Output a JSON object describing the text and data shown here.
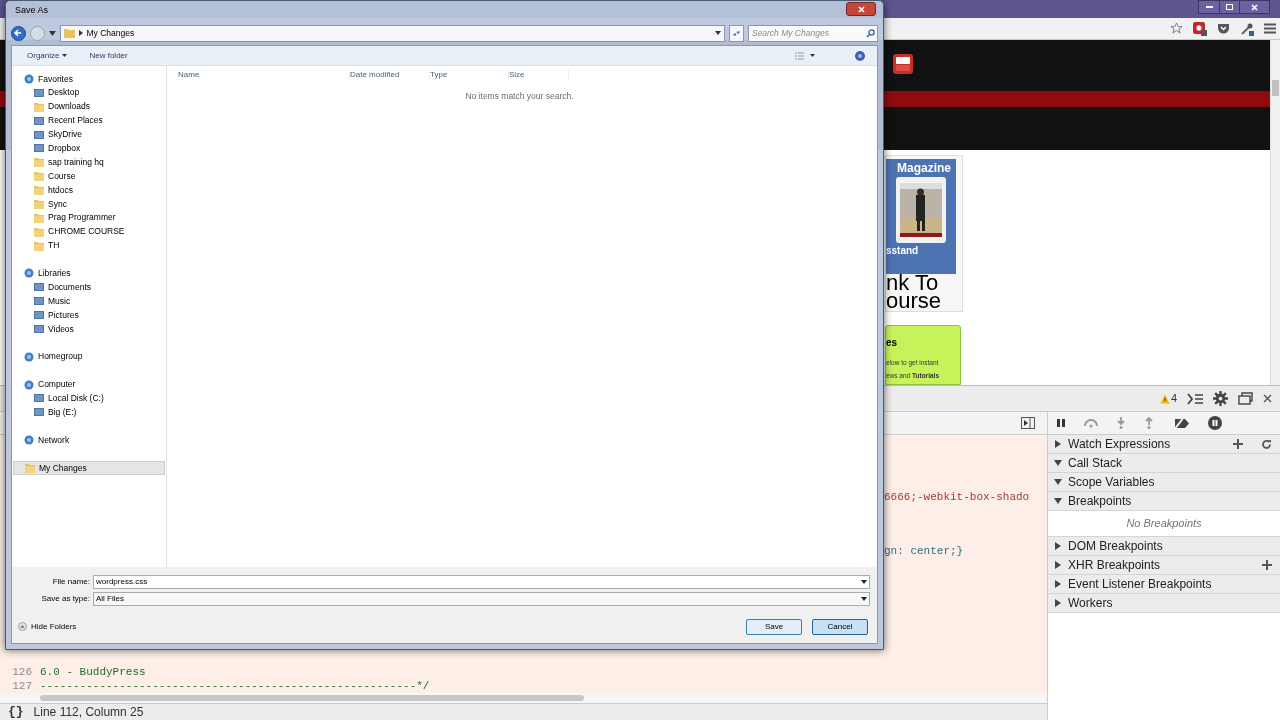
{
  "browser": {
    "page": {
      "magazine_title": "Magazine",
      "magazine_caption": "sstand",
      "link_lines": [
        "nk To",
        "ourse"
      ],
      "promo_heading": "es",
      "promo_lines": [
        "elow to get instant",
        "ews and **Tutorials**"
      ]
    }
  },
  "devtools": {
    "warning_count": "4",
    "code_fragments": [
      {
        "text": "6666;-webkit-box-shado",
        "kind": "property"
      },
      {
        "text": "gn: center;}",
        "kind": "value"
      }
    ],
    "code_lines": [
      {
        "number": "126",
        "text": "6.0 - BuddyPress"
      },
      {
        "number": "127",
        "text": "---------------------------------------------------------*/"
      }
    ],
    "sidebar": [
      {
        "label": "Watch Expressions",
        "expanded": false,
        "has_add": true,
        "has_refresh": true
      },
      {
        "label": "Call Stack",
        "expanded": true,
        "has_add": false,
        "has_refresh": false
      },
      {
        "label": "Scope Variables",
        "expanded": true,
        "has_add": false,
        "has_refresh": false
      },
      {
        "label": "Breakpoints",
        "expanded": true,
        "has_add": false,
        "has_refresh": false,
        "empty_text": "No Breakpoints"
      },
      {
        "label": "DOM Breakpoints",
        "expanded": false,
        "has_add": false,
        "has_refresh": false
      },
      {
        "label": "XHR Breakpoints",
        "expanded": false,
        "has_add": true,
        "has_refresh": false
      },
      {
        "label": "Event Listener Breakpoints",
        "expanded": false,
        "has_add": false,
        "has_refresh": false
      },
      {
        "label": "Workers",
        "expanded": false,
        "has_add": false,
        "has_refresh": false
      }
    ],
    "format_button": "{}",
    "status": "Line 112, Column 25"
  },
  "dialog": {
    "title": "Save As",
    "path": "My Changes",
    "search_placeholder": "Search My Changes",
    "toolbar": [
      {
        "label": "Organize",
        "dropdown": true
      },
      {
        "label": "New folder",
        "dropdown": false
      }
    ],
    "nav": [
      {
        "label": "Favorites",
        "kind": "place",
        "selected": false,
        "children": [
          {
            "label": "Desktop",
            "kind": "place",
            "selected": false
          },
          {
            "label": "Downloads",
            "kind": "folder",
            "selected": false
          },
          {
            "label": "Recent Places",
            "kind": "place",
            "selected": false
          },
          {
            "label": "SkyDrive",
            "kind": "place",
            "selected": false
          },
          {
            "label": "Dropbox",
            "kind": "place",
            "selected": false
          },
          {
            "label": "sap training hq",
            "kind": "folder",
            "selected": false
          },
          {
            "label": "Course",
            "kind": "folder",
            "selected": false
          },
          {
            "label": "htdocs",
            "kind": "folder",
            "selected": false
          },
          {
            "label": "Sync",
            "kind": "folder",
            "selected": false
          },
          {
            "label": "Prag Programmer",
            "kind": "folder",
            "selected": false
          },
          {
            "label": "CHROME COURSE",
            "kind": "folder",
            "selected": false
          },
          {
            "label": "TH",
            "kind": "folder",
            "selected": false
          }
        ]
      },
      {
        "label": "Libraries",
        "kind": "place",
        "selected": false,
        "children": [
          {
            "label": "Documents",
            "kind": "place",
            "selected": false
          },
          {
            "label": "Music",
            "kind": "place",
            "selected": false
          },
          {
            "label": "Pictures",
            "kind": "place",
            "selected": false
          },
          {
            "label": "Videos",
            "kind": "place",
            "selected": false
          }
        ]
      },
      {
        "label": "Homegroup",
        "kind": "place",
        "selected": false
      },
      {
        "label": "Computer",
        "kind": "place",
        "selected": false,
        "children": [
          {
            "label": "Local Disk (C:)",
            "kind": "place",
            "selected": false
          },
          {
            "label": "Big (E:)",
            "kind": "place",
            "selected": false
          }
        ]
      },
      {
        "label": "Network",
        "kind": "place",
        "selected": false
      },
      {
        "label": "My Changes",
        "kind": "folder",
        "selected": true
      }
    ],
    "columns": [
      "Name",
      "Date modified",
      "Type",
      "Size"
    ],
    "empty_message": "No items match your search.",
    "file_name_label": "File name:",
    "file_name": "wordpress.css",
    "type_label": "Save as type:",
    "type_value": "All Files",
    "hide_folders": "Hide Folders",
    "buttons": [
      {
        "label": "Save",
        "kind": "default"
      },
      {
        "label": "Cancel",
        "kind": "hover"
      }
    ]
  }
}
